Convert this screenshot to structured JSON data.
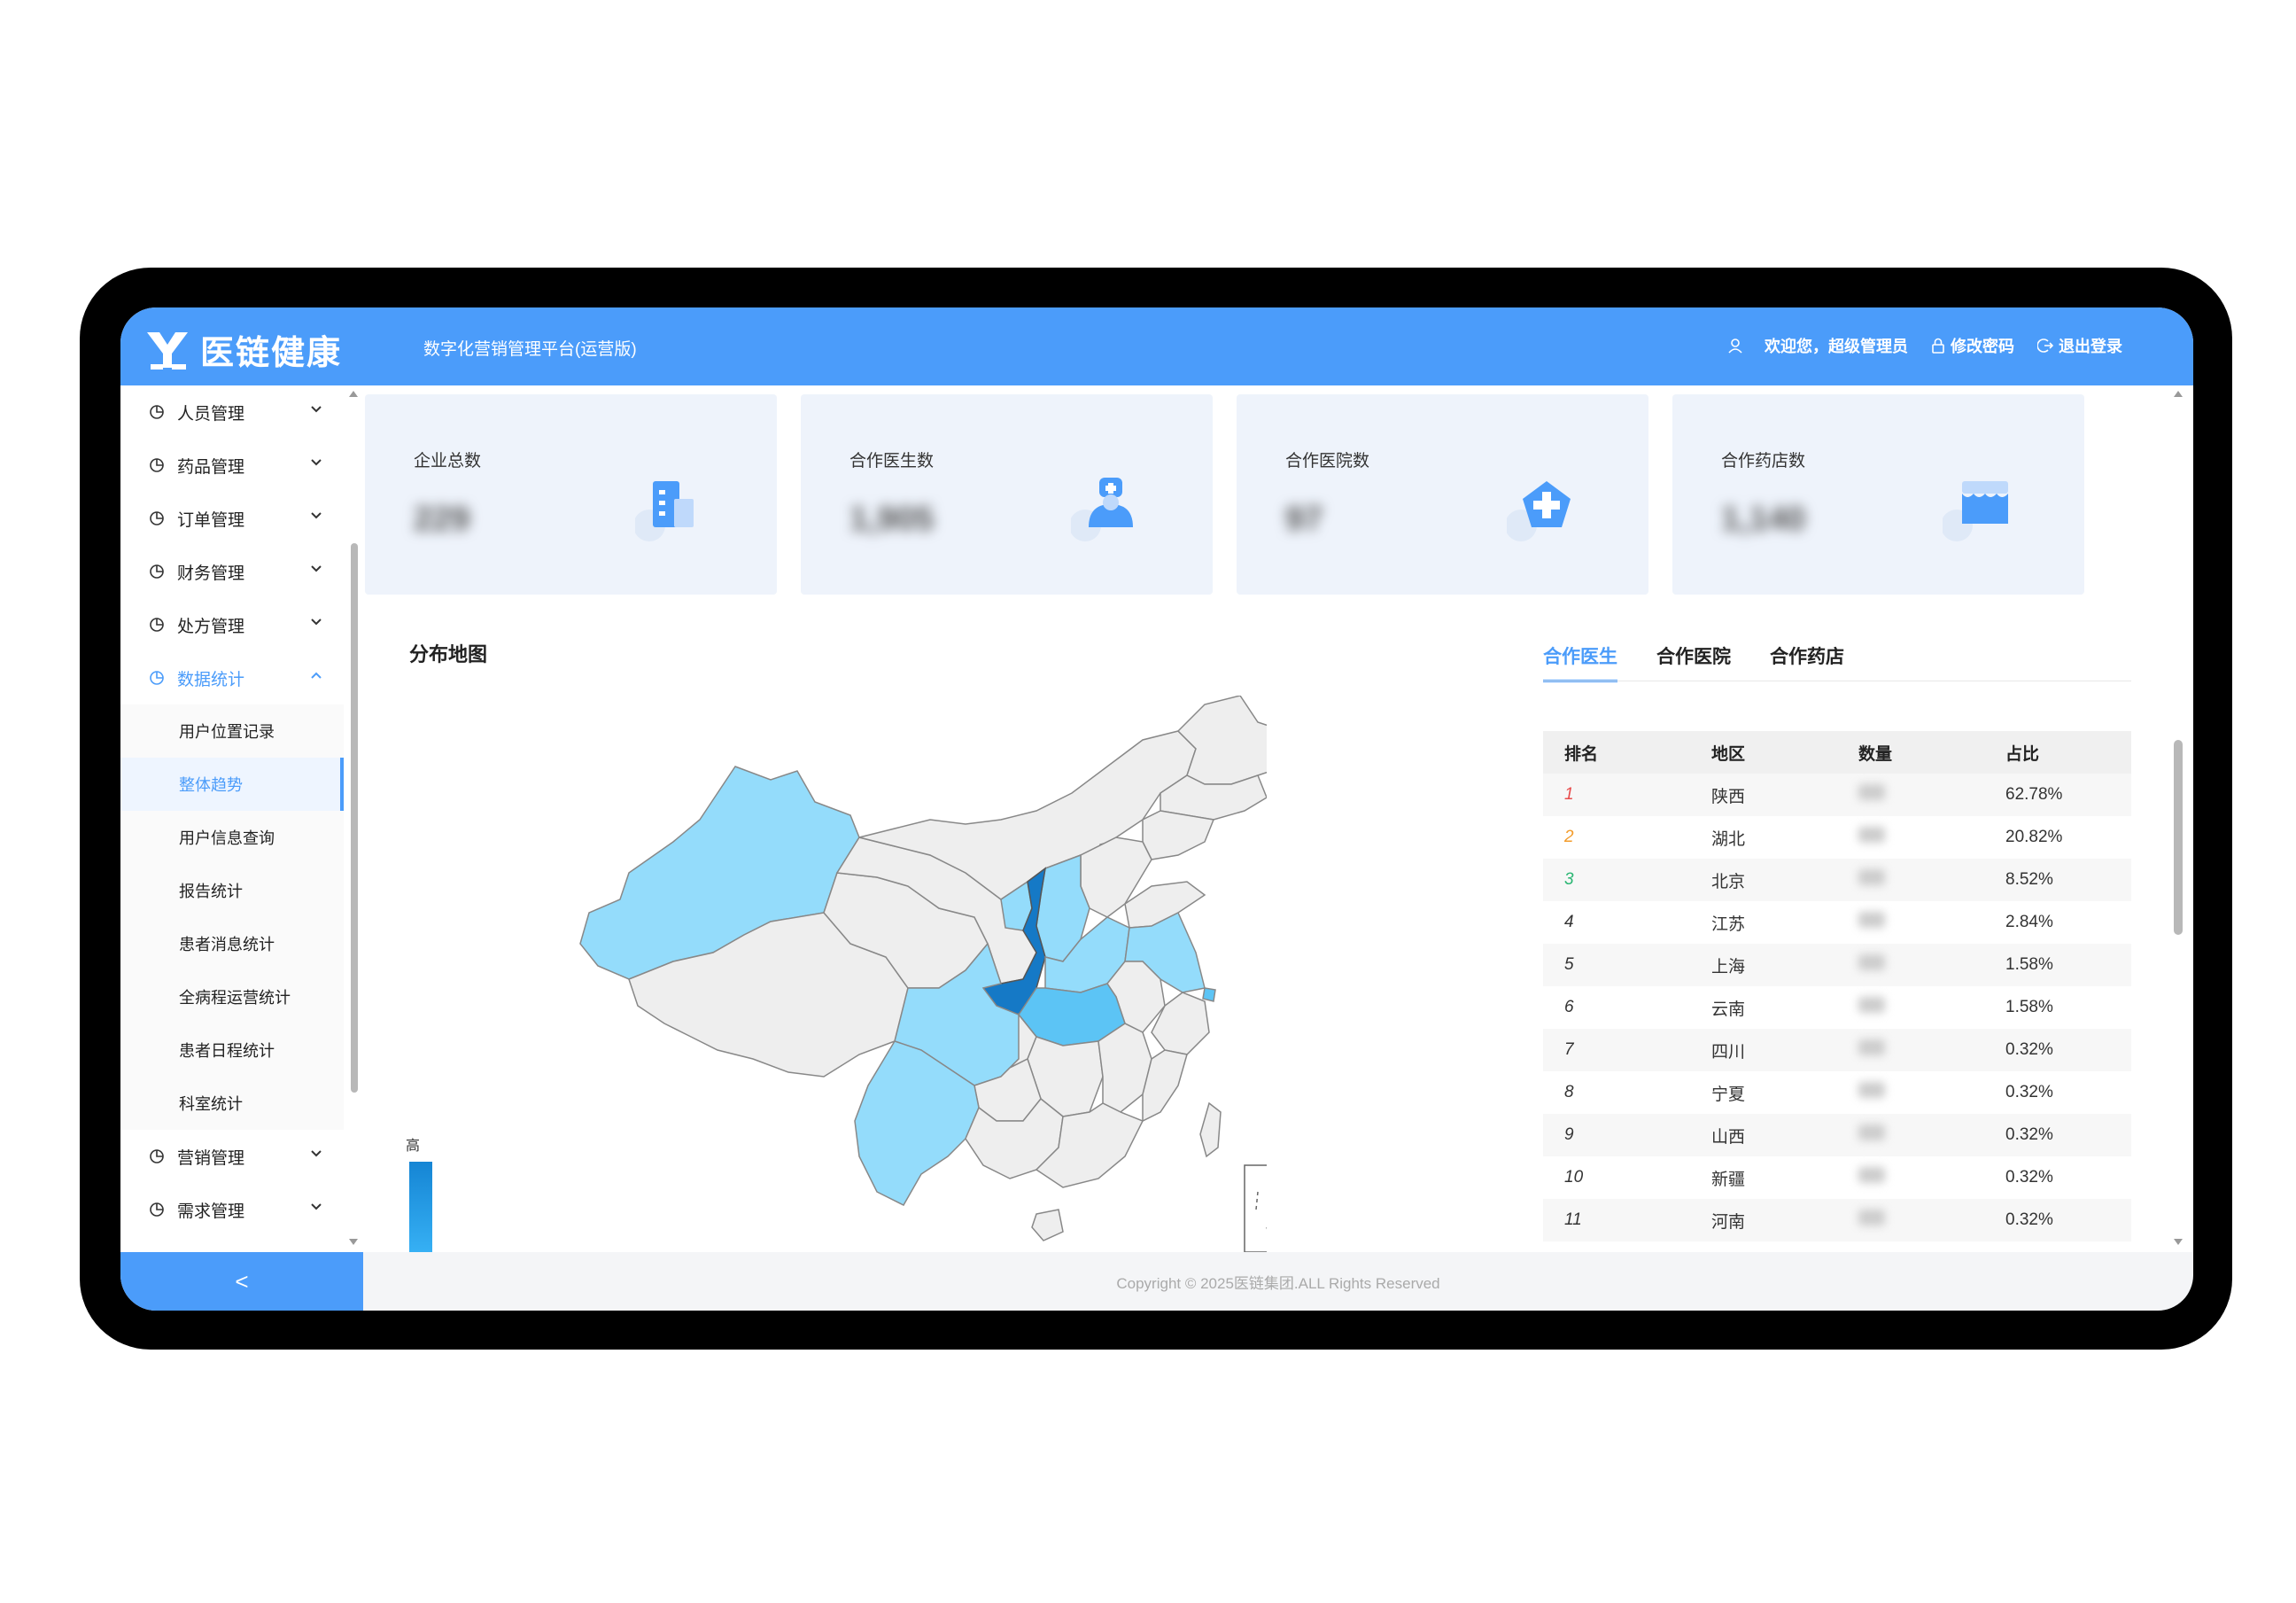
{
  "header": {
    "logo_text": "医链健康",
    "platform_title": "数字化营销管理平台(运营版)",
    "welcome": "欢迎您，超级管理员",
    "change_password": "修改密码",
    "logout": "退出登录"
  },
  "sidebar": {
    "items_top": [
      {
        "label": "人员管理"
      },
      {
        "label": "药品管理"
      },
      {
        "label": "订单管理"
      },
      {
        "label": "财务管理"
      },
      {
        "label": "处方管理"
      }
    ],
    "open_item": {
      "label": "数据统计"
    },
    "sub_items": [
      {
        "label": "用户位置记录"
      },
      {
        "label": "整体趋势"
      },
      {
        "label": "用户信息查询"
      },
      {
        "label": "报告统计"
      },
      {
        "label": "患者消息统计"
      },
      {
        "label": "全病程运营统计"
      },
      {
        "label": "患者日程统计"
      },
      {
        "label": "科室统计"
      }
    ],
    "items_bottom": [
      {
        "label": "营销管理"
      },
      {
        "label": "需求管理"
      }
    ],
    "collapse_label": "<"
  },
  "stats": [
    {
      "label": "企业总数",
      "value": "229"
    },
    {
      "label": "合作医生数",
      "value": "1,905"
    },
    {
      "label": "合作医院数",
      "value": "97"
    },
    {
      "label": "合作药店数",
      "value": "1,140"
    }
  ],
  "map": {
    "title": "分布地图",
    "legend_high": "高"
  },
  "tabs": [
    {
      "label": "合作医生"
    },
    {
      "label": "合作医院"
    },
    {
      "label": "合作药店"
    }
  ],
  "table": {
    "headers": [
      "排名",
      "地区",
      "数量",
      "占比"
    ],
    "rows": [
      {
        "rank": "1",
        "region": "陕西",
        "share": "62.78%"
      },
      {
        "rank": "2",
        "region": "湖北",
        "share": "20.82%"
      },
      {
        "rank": "3",
        "region": "北京",
        "share": "8.52%"
      },
      {
        "rank": "4",
        "region": "江苏",
        "share": "2.84%"
      },
      {
        "rank": "5",
        "region": "上海",
        "share": "1.58%"
      },
      {
        "rank": "6",
        "region": "云南",
        "share": "1.58%"
      },
      {
        "rank": "7",
        "region": "四川",
        "share": "0.32%"
      },
      {
        "rank": "8",
        "region": "宁夏",
        "share": "0.32%"
      },
      {
        "rank": "9",
        "region": "山西",
        "share": "0.32%"
      },
      {
        "rank": "10",
        "region": "新疆",
        "share": "0.32%"
      },
      {
        "rank": "11",
        "region": "河南",
        "share": "0.32%"
      }
    ]
  },
  "footer": {
    "copyright": "Copyright © 2025医链集团.ALL Rights Reserved"
  },
  "colors": {
    "accent": "#4b9cfa",
    "map_high": "#1579c6",
    "map_mid": "#5cc4f5",
    "map_low": "#94dcfb",
    "map_none": "#eeeeee"
  }
}
